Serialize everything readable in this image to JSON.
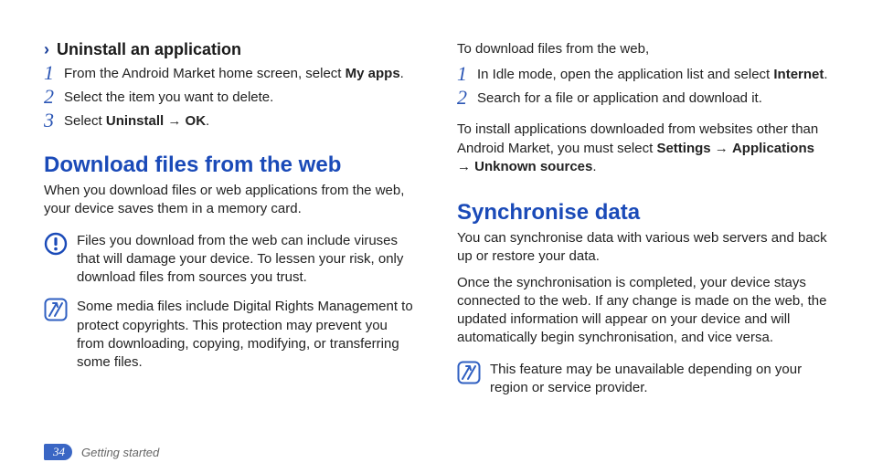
{
  "left": {
    "subhead": "Uninstall an application",
    "steps": [
      {
        "n": "1",
        "pre": "From the Android Market home screen, select ",
        "b": "My apps",
        "post": "."
      },
      {
        "n": "2",
        "pre": "Select the item you want to delete.",
        "b": "",
        "post": ""
      },
      {
        "n": "3",
        "pre": "Select ",
        "b": "Uninstall",
        "mid": " → ",
        "b2": "OK",
        "post": "."
      }
    ],
    "h2": "Download files from the web",
    "intro": "When you download files or web applications from the web, your device saves them in a memory card.",
    "warn": "Files you download from the web can include viruses that will damage your device. To lessen your risk, only download files from sources you trust.",
    "note": "Some media files include Digital Rights Management to protect copyrights. This protection may prevent you from downloading, copying, modifying, or transferring some files."
  },
  "right": {
    "lead": "To download files from the web,",
    "steps": [
      {
        "n": "1",
        "pre": "In Idle mode, open the application list and select ",
        "b": "Internet",
        "post": "."
      },
      {
        "n": "2",
        "pre": "Search for a file or application and download it.",
        "b": "",
        "post": ""
      }
    ],
    "install_pre": "To install applications downloaded from websites other than Android Market, you must select ",
    "install_b1": "Settings",
    "install_a1": " → ",
    "install_b2": "Applications",
    "install_a2": " → ",
    "install_b3": "Unknown sources",
    "install_post": ".",
    "h2": "Synchronise data",
    "sync1": "You can synchronise data with various web servers and back up or restore your data.",
    "sync2": "Once the synchronisation is completed, your device stays connected to the web. If any change is made on the web, the updated information will appear on your device and will automatically begin synchronisation, and vice versa.",
    "note": "This feature may be unavailable depending on your region or service provider."
  },
  "footer": {
    "page": "34",
    "section": "Getting started"
  }
}
